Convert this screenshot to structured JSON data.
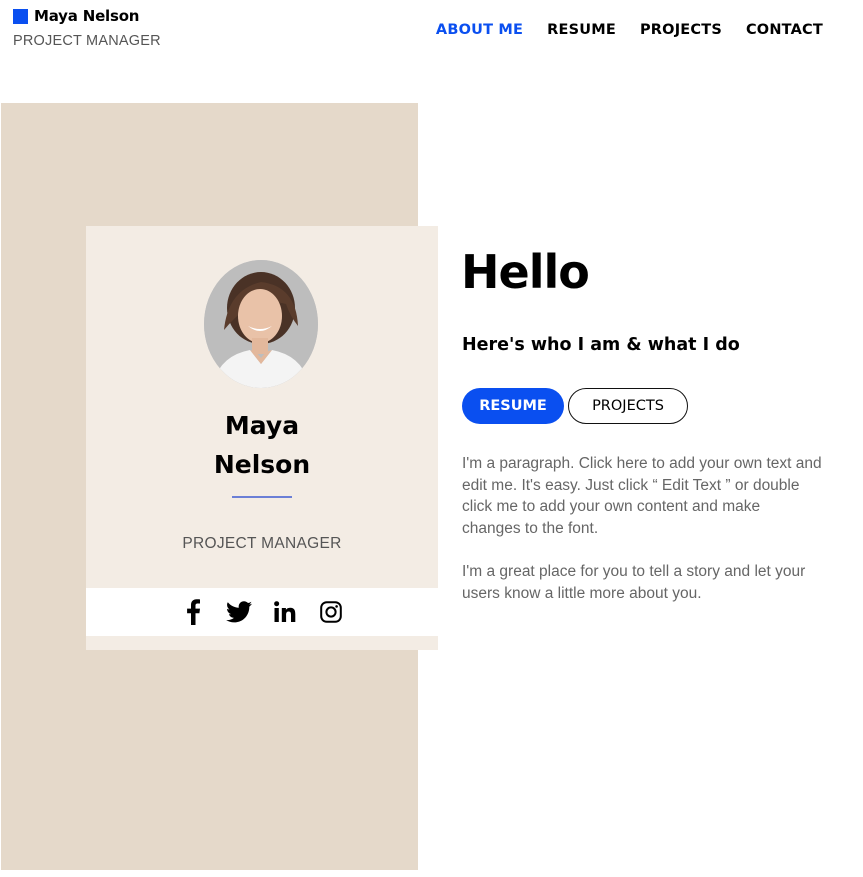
{
  "colors": {
    "accent": "#0a4ff0",
    "beige_panel": "#e5d9ca",
    "card_bg": "#f3ece4",
    "divider": "#6b7fd6"
  },
  "header": {
    "brand_name": "Maya Nelson",
    "brand_role": "PROJECT MANAGER"
  },
  "nav": {
    "items": [
      {
        "label": "ABOUT ME",
        "active": true
      },
      {
        "label": "RESUME",
        "active": false
      },
      {
        "label": "PROJECTS",
        "active": false
      },
      {
        "label": "CONTACT",
        "active": false
      }
    ]
  },
  "card": {
    "name": "Maya\nNelson",
    "role": "PROJECT MANAGER",
    "social": [
      "facebook-icon",
      "twitter-icon",
      "linkedin-icon",
      "instagram-icon"
    ]
  },
  "main": {
    "heading": "Hello",
    "subtitle": "Here's who I am & what I do",
    "resume_button": "RESUME",
    "projects_button": "PROJECTS",
    "paragraph1": "I'm a paragraph. Click here to add your own text and edit me. It's easy. Just click “ Edit Text ” or double click me to add your own content and make changes to the font.",
    "paragraph2": "I'm a great place for you to tell a story and let your users know a little more about you."
  }
}
